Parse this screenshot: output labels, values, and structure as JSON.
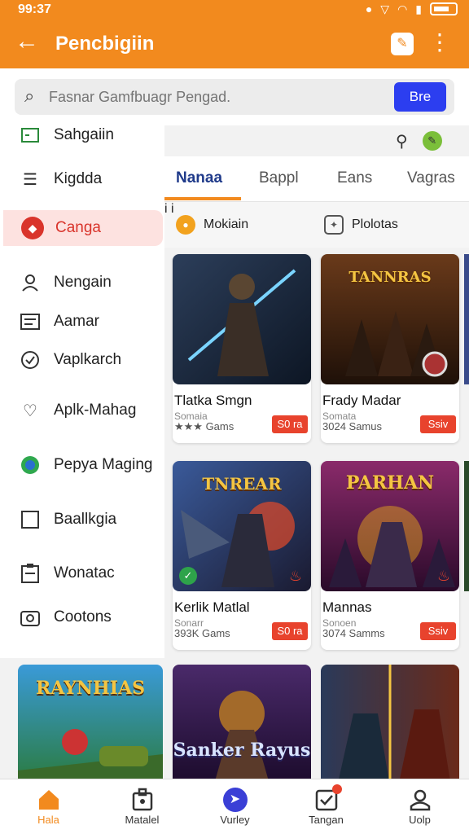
{
  "status": {
    "time": "99:37"
  },
  "appbar": {
    "title": "Pencbigiin"
  },
  "search": {
    "placeholder": "Fasnar Gamfbuagr Pengad.",
    "button_label": "Bre"
  },
  "sidebar": {
    "items": [
      {
        "label": "Sahgaiin",
        "icon": "book-icon"
      },
      {
        "label": "Kigdda",
        "icon": "menu-icon"
      },
      {
        "label": "Canga",
        "icon": "game-icon",
        "active": true
      },
      {
        "label": "Nengain",
        "icon": "person-icon"
      },
      {
        "label": "Aamar",
        "icon": "list-icon"
      },
      {
        "label": "Vaplkarch",
        "icon": "check-circle-icon"
      },
      {
        "label": "Aplk-Mahag",
        "icon": "heart-icon"
      },
      {
        "label": "Pepya Maging",
        "icon": "chat-icon"
      },
      {
        "label": "Baallkgia",
        "icon": "square-icon"
      },
      {
        "label": "Wonatac",
        "icon": "clipboard-icon"
      },
      {
        "label": "Cootons",
        "icon": "camera-icon"
      }
    ]
  },
  "tabs": [
    "Nanaa",
    "Bappl",
    "Eans",
    "Vagras"
  ],
  "filters": [
    {
      "label": "Mokiain",
      "icon": "coin-icon"
    },
    {
      "label": "Plolotas",
      "icon": "puzzle-icon"
    }
  ],
  "cards": [
    {
      "title": "Tlatka Smgn",
      "meta": "Somaia",
      "sub": "★★★ Gams",
      "price": "S0 ra",
      "logo": ""
    },
    {
      "title": "Frady Madar",
      "meta": "Somata",
      "sub": "3024 Samus",
      "price": "Ssiv",
      "logo": "TANNRAS"
    },
    {
      "title": "Kerlik Matlal",
      "meta": "Sonarr",
      "sub": "393K Gams",
      "price": "S0 ra",
      "logo": "TNREAR"
    },
    {
      "title": "Mannas",
      "meta": "Sonoen",
      "sub": "3074 Samms",
      "price": "Ssiv",
      "logo": "PARHAN"
    }
  ],
  "bottom_logos": [
    "RAYNHIAS",
    "Sanker Rayus"
  ],
  "nav": [
    {
      "label": "Hala",
      "icon": "home-icon",
      "active": true
    },
    {
      "label": "Matalel",
      "icon": "bag-icon"
    },
    {
      "label": "Vurley",
      "icon": "compass-icon"
    },
    {
      "label": "Tangan",
      "icon": "checkbox-icon"
    },
    {
      "label": "Uolp",
      "icon": "user-icon"
    }
  ]
}
